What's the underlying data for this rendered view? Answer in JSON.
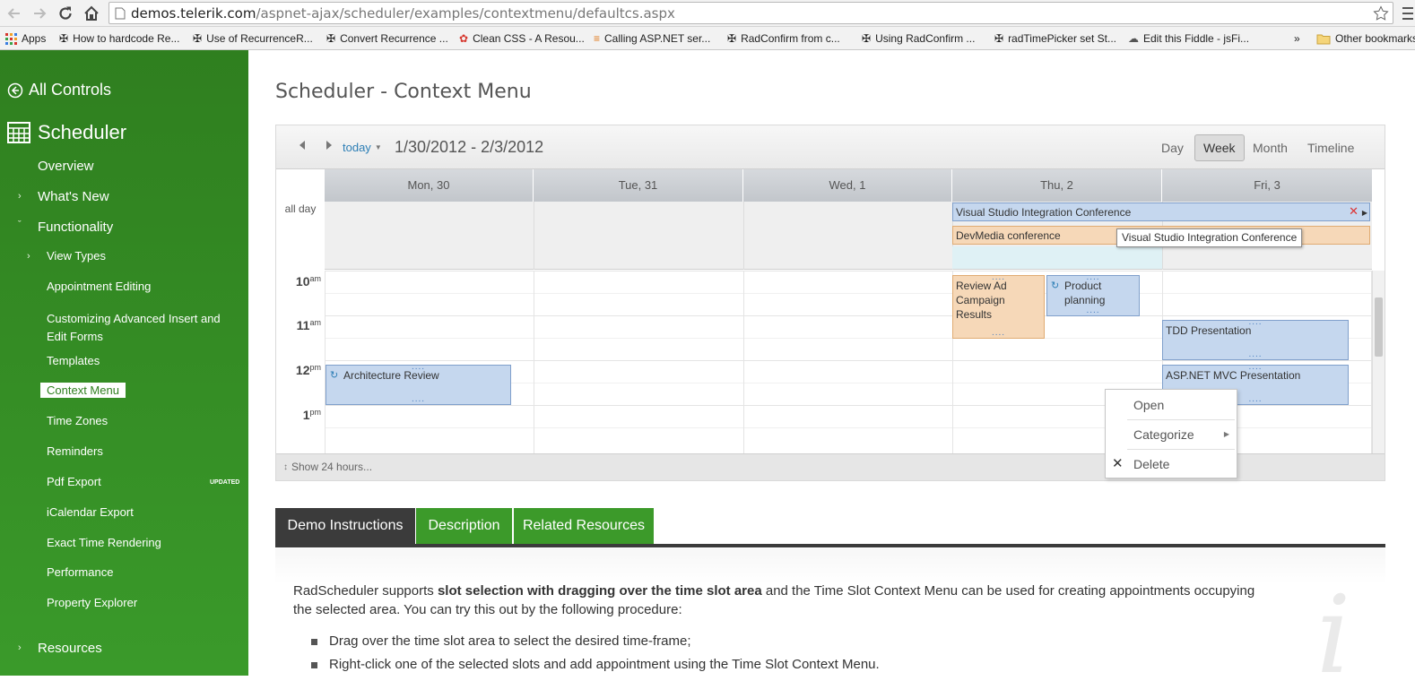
{
  "browser": {
    "url_host": "demos.telerik.com",
    "url_path": "/aspnet-ajax/scheduler/examples/contextmenu/defaultcs.aspx",
    "bookmarks": [
      "Apps",
      "How to hardcode Re...",
      "Use of RecurrenceR...",
      "Convert Recurrence ...",
      "Clean CSS - A Resou...",
      "Calling ASP.NET ser...",
      "RadConfirm from c...",
      "Using RadConfirm ...",
      "radTimePicker set St...",
      "Edit this Fiddle - jsFi...",
      "»",
      "Other bookmarks"
    ]
  },
  "sidebar": {
    "all_controls": "All Controls",
    "scheduler": "Scheduler",
    "items": [
      "Overview",
      "What's New",
      "Functionality",
      "View Types",
      "Appointment Editing",
      "Customizing Advanced Insert and Edit Forms",
      "Templates",
      "Context Menu",
      "Time Zones",
      "Reminders",
      "Pdf Export",
      "iCalendar Export",
      "Exact Time Rendering",
      "Performance",
      "Property Explorer",
      "Resources"
    ],
    "customizing_line1": "Customizing Advanced Insert and",
    "customizing_line2": "Edit Forms",
    "updated_badge": "UPDATED"
  },
  "main": {
    "page_title": "Scheduler - Context Menu"
  },
  "scheduler": {
    "today_label": "today",
    "date_range": "1/30/2012 - 2/3/2012",
    "views": [
      "Day",
      "Week",
      "Month",
      "Timeline"
    ],
    "active_view": "Week",
    "days": [
      "Mon, 30",
      "Tue, 31",
      "Wed, 1",
      "Thu, 2",
      "Fri, 3"
    ],
    "all_day_label": "all day",
    "hours": [
      {
        "hour": "10",
        "ampm": "am"
      },
      {
        "hour": "11",
        "ampm": "am"
      },
      {
        "hour": "12",
        "ampm": "pm"
      },
      {
        "hour": "1",
        "ampm": "pm"
      }
    ],
    "appointments": {
      "vs_conf": "Visual Studio Integration Conference",
      "devmedia": "DevMedia conference",
      "review_ad": "Review Ad Campaign Results",
      "product_planning": "Product planning",
      "tdd": "TDD Presentation",
      "arch_review": "Architecture Review",
      "aspnet_mvc": "ASP.NET MVC Presentation"
    },
    "tooltip": "Visual Studio Integration Conference",
    "show_24": "Show 24 hours..."
  },
  "context_menu": {
    "items": [
      "Open",
      "Categorize",
      "Delete"
    ]
  },
  "tabs": [
    "Demo Instructions",
    "Description",
    "Related Resources"
  ],
  "instructions": {
    "para_a": "RadScheduler supports ",
    "para_bold": "slot selection with dragging over the time slot area",
    "para_b": " and the Time Slot Context Menu can be used for creating appointments occupying the selected area. You can try this out by the following procedure:",
    "bullets": [
      "Drag over the time slot area to select the desired time-frame;",
      "Right-click one of the selected slots and add appointment using the Time Slot Context Menu."
    ]
  },
  "colors": {
    "sidebar_green": "#3a9a2a",
    "tab_dark": "#3b3b3b",
    "tab_green": "#3c9a2a",
    "appt_blue": "#c5d7ee",
    "appt_orange": "#f6d8b8"
  }
}
